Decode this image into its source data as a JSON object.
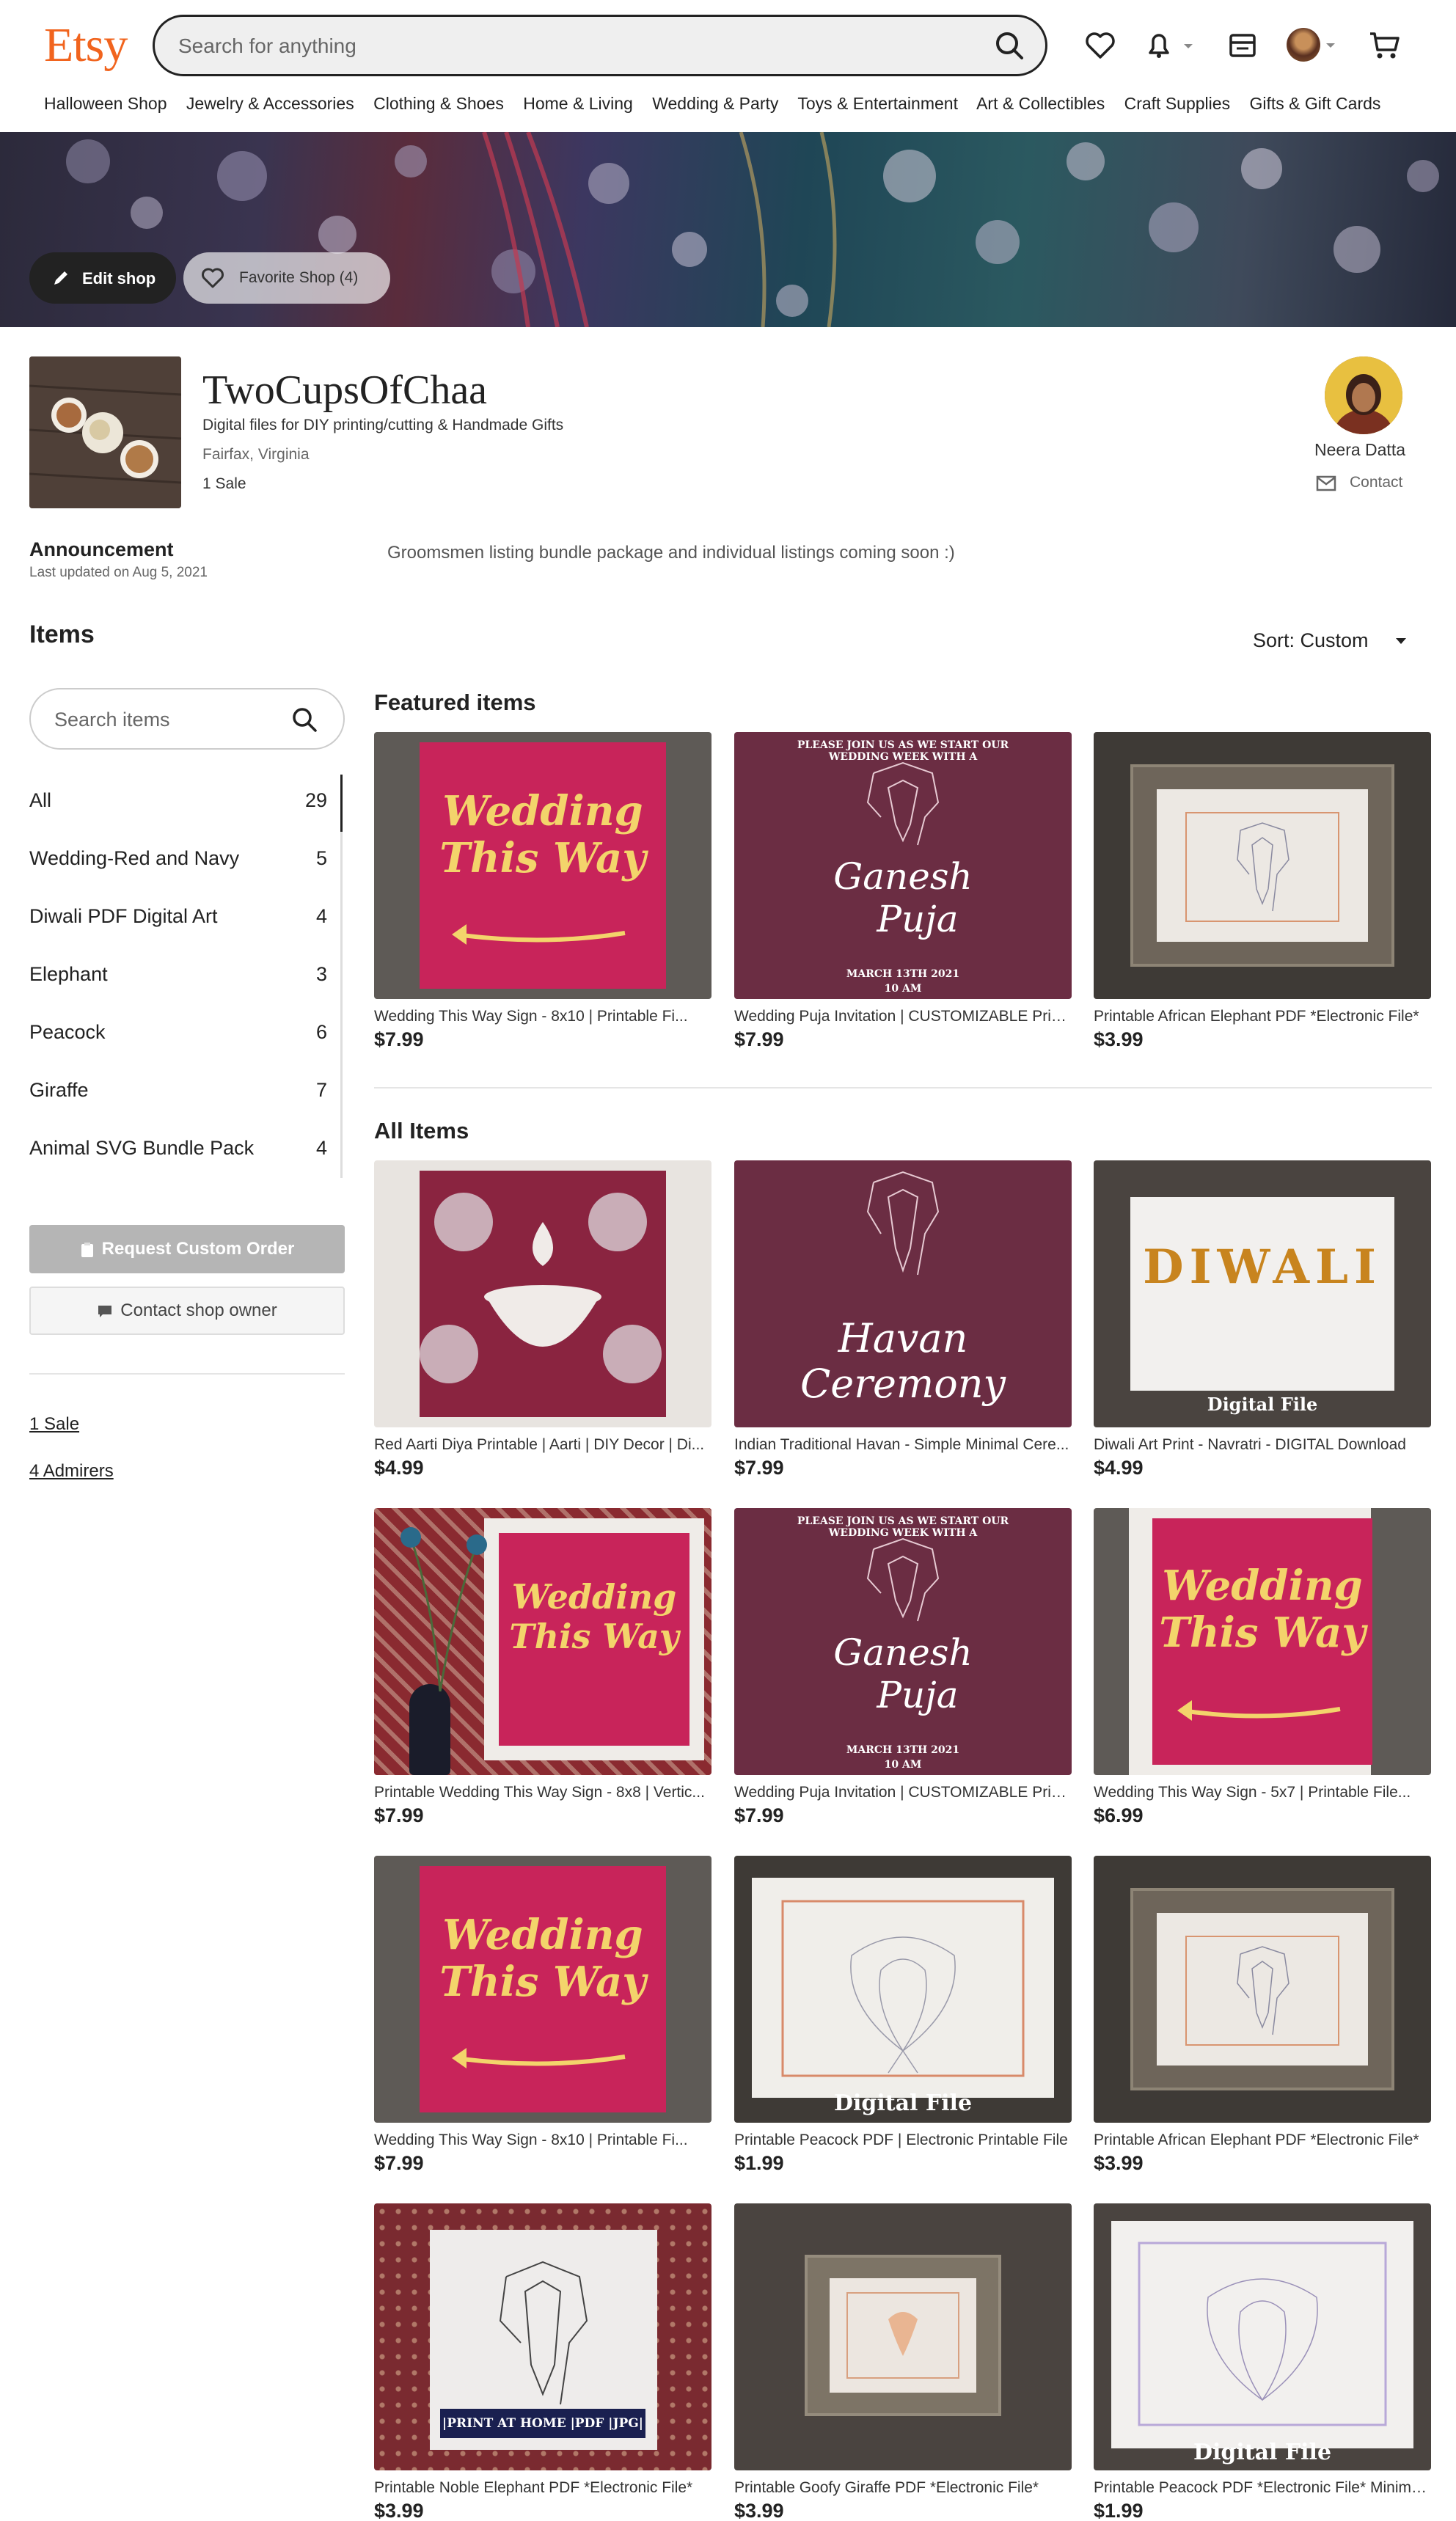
{
  "header": {
    "logo": "Etsy",
    "search_placeholder": "Search for anything",
    "nav": [
      "Halloween Shop",
      "Jewelry & Accessories",
      "Clothing & Shoes",
      "Home & Living",
      "Wedding & Party",
      "Toys & Entertainment",
      "Art & Collectibles",
      "Craft Supplies",
      "Gifts & Gift Cards"
    ]
  },
  "banner": {
    "edit_label": "Edit shop",
    "favorite_label": "Favorite Shop (4)"
  },
  "shop": {
    "name": "TwoCupsOfChaa",
    "tagline": "Digital files for DIY printing/cutting & Handmade Gifts",
    "location": "Fairfax, Virginia",
    "sales": "1 Sale",
    "owner_name": "Neera Datta",
    "contact_label": "Contact"
  },
  "announcement": {
    "title": "Announcement",
    "updated": "Last updated on Aug 5, 2021",
    "text": "Groomsmen listing bundle package and individual listings coming soon :)"
  },
  "items": {
    "title": "Items",
    "sort_label": "Sort: Custom",
    "search_placeholder": "Search items"
  },
  "categories": [
    {
      "label": "All",
      "count": "29"
    },
    {
      "label": "Wedding-Red and Navy",
      "count": "5"
    },
    {
      "label": "Diwali PDF Digital Art",
      "count": "4"
    },
    {
      "label": "Elephant",
      "count": "3"
    },
    {
      "label": "Peacock",
      "count": "6"
    },
    {
      "label": "Giraffe",
      "count": "7"
    },
    {
      "label": "Animal SVG Bundle Pack",
      "count": "4"
    }
  ],
  "sidebar": {
    "request_label": "Request Custom Order",
    "contact_owner_label": "Contact shop owner",
    "sales_link": "1 Sale",
    "admirers_link": "4 Admirers"
  },
  "featured": {
    "title": "Featured items",
    "items": [
      {
        "title": "Wedding This Way Sign - 8x10 | Printable Fi...",
        "price": "$7.99"
      },
      {
        "title": "Wedding Puja Invitation | CUSTOMIZABLE Printa...",
        "price": "$7.99"
      },
      {
        "title": "Printable African Elephant PDF *Electronic File*",
        "price": "$3.99"
      }
    ]
  },
  "all_items": {
    "title": "All Items",
    "items": [
      {
        "title": "Red Aarti Diya Printable | Aarti | DIY Decor | Di...",
        "price": "$4.99"
      },
      {
        "title": "Indian Traditional Havan - Simple Minimal Cere...",
        "price": "$7.99"
      },
      {
        "title": "Diwali Art Print - Navratri - DIGITAL Download",
        "price": "$4.99"
      },
      {
        "title": "Printable Wedding This Way Sign - 8x8 | Vertic...",
        "price": "$7.99"
      },
      {
        "title": "Wedding Puja Invitation | CUSTOMIZABLE Printa...",
        "price": "$7.99"
      },
      {
        "title": "Wedding This Way Sign - 5x7 | Printable File...",
        "price": "$6.99"
      },
      {
        "title": "Wedding This Way Sign - 8x10 | Printable Fi...",
        "price": "$7.99"
      },
      {
        "title": "Printable Peacock PDF | Electronic Printable File",
        "price": "$1.99"
      },
      {
        "title": "Printable African Elephant PDF *Electronic File*",
        "price": "$3.99"
      },
      {
        "title": "Printable Noble Elephant PDF *Electronic File*",
        "price": "$3.99"
      },
      {
        "title": "Printable Goofy Giraffe PDF *Electronic File*",
        "price": "$3.99"
      },
      {
        "title": "Printable Peacock PDF *Electronic File* Minimal...",
        "price": "$1.99"
      }
    ]
  },
  "art_text": {
    "wedding_line1": "Wedding",
    "wedding_line2": "This Way",
    "invite_caption": "PLEASE JOIN US AS WE START OUR WEDDING WEEK WITH A",
    "ganesh_line1": "Ganesh",
    "ganesh_line2": "Puja",
    "puja_date": "MARCH 13TH 2021",
    "puja_time": "10 AM",
    "havan_line1": "Havan",
    "havan_line2": "Ceremony",
    "diwali": "DIWALI",
    "digital_file": "Digital File",
    "print_at_home": "|PRINT AT HOME |PDF |JPG|"
  },
  "colors": {
    "brand": "#f1641e",
    "wedding_pink": "#c8245a",
    "invite_maroon": "#6b2d43",
    "frame_wood": "#6e655a"
  }
}
